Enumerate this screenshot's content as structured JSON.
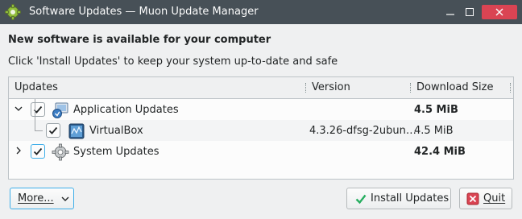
{
  "window": {
    "title": "Software Updates — Muon Update Manager",
    "controls": {
      "minimize": "_",
      "maximize": "□",
      "close": "✕"
    }
  },
  "main": {
    "heading": "New software is available for your computer",
    "description": "Click 'Install Updates' to keep your system up-to-date and safe"
  },
  "tree": {
    "columns": {
      "updates": "Updates",
      "version": "Version",
      "download_size": "Download Size"
    },
    "rows": [
      {
        "name": "Application Updates",
        "version": "",
        "size": "4.5 MiB",
        "checked": true,
        "expanded": true,
        "icon": "application-updates-icon"
      },
      {
        "name": "VirtualBox",
        "version": "4.3.26-dfsg-2ubun…",
        "size": "4.5 MiB",
        "checked": true,
        "icon": "virtualbox-icon"
      },
      {
        "name": "System Updates",
        "version": "",
        "size": "42.4 MiB",
        "checked": true,
        "expanded": false,
        "icon": "gear-icon"
      }
    ]
  },
  "buttons": {
    "more": "More...",
    "install": "Install Updates",
    "quit": "Quit"
  },
  "colors": {
    "titlebar": "#475057",
    "accent": "#3daee9",
    "close": "#da4453",
    "install_icon": "#27ae60",
    "quit_icon": "#da4453"
  }
}
